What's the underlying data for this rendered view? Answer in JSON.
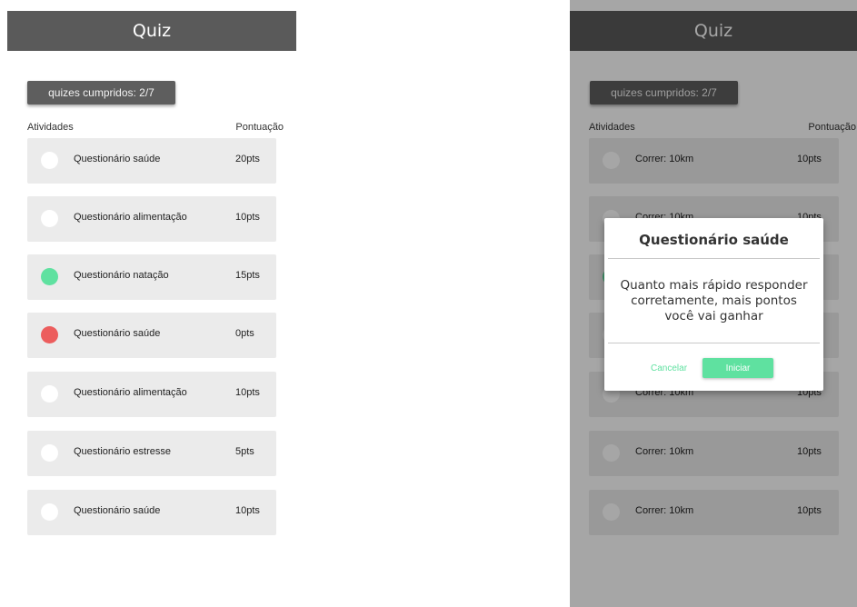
{
  "left_screen": {
    "header_title": "Quiz",
    "completed_badge": "quizes cumpridos: 2/7",
    "col_activities": "Atividades",
    "col_score": "Pontuação",
    "items": [
      {
        "title": "Questionário saúde",
        "score": "20pts",
        "status": "pending"
      },
      {
        "title": "Questionário alimentação",
        "score": "10pts",
        "status": "pending"
      },
      {
        "title": "Questionário natação",
        "score": "15pts",
        "status": "success"
      },
      {
        "title": "Questionário saúde",
        "score": "0pts",
        "status": "failed"
      },
      {
        "title": "Questionário alimentação",
        "score": "10pts",
        "status": "pending"
      },
      {
        "title": "Questionário estresse",
        "score": "5pts",
        "status": "pending"
      },
      {
        "title": "Questionário saúde",
        "score": "10pts",
        "status": "pending"
      }
    ]
  },
  "right_screen": {
    "header_title": "Quiz",
    "completed_badge": "quizes cumpridos: 2/7",
    "col_activities": "Atividades",
    "col_score": "Pontuação",
    "items": [
      {
        "title": "Correr: 10km",
        "score": "10pts",
        "status": "pending"
      },
      {
        "title": "Correr: 10km",
        "score": "10pts",
        "status": "pending"
      },
      {
        "title": "",
        "score": "",
        "status": "success"
      },
      {
        "title": "",
        "score": "",
        "status": "pending"
      },
      {
        "title": "Correr: 10km",
        "score": "10pts",
        "status": "pending"
      },
      {
        "title": "Correr: 10km",
        "score": "10pts",
        "status": "pending"
      },
      {
        "title": "Correr: 10km",
        "score": "10pts",
        "status": "pending"
      }
    ],
    "dialog": {
      "title": "Questionário saúde",
      "message": "Quanto mais rápido responder corretamente, mais pontos você vai ganhar",
      "cancel_label": "Cancelar",
      "start_label": "Iniciar"
    }
  },
  "colors": {
    "header": "#5a5a5a",
    "accent_green": "#5fe1a0",
    "accent_red": "#ec5d5d",
    "row_background": "#ebebeb"
  }
}
